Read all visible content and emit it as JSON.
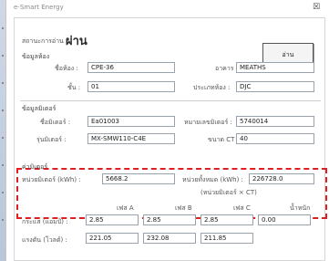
{
  "window": {
    "title": "e-Smart Energy",
    "close_label": "☒"
  },
  "status": {
    "label": "สถานะการอ่าน",
    "value": "ผ่าน",
    "button": "อ่าน"
  },
  "room": {
    "section": "ข้อมูลห้อง",
    "name_label": "ชื่อห้อง :",
    "name": "CPE-36",
    "building_label": "อาคาร :",
    "building": "MEATHS",
    "floor_label": "ชั้น :",
    "floor": "01",
    "type_label": "ประเภทห้อง :",
    "type": "DJC"
  },
  "meter": {
    "section": "ข้อมูลมิเตอร์",
    "name_label": "ชื่อมิเตอร์ :",
    "name": "Ea01003",
    "serial_label": "หมายเลขมิเตอร์ :",
    "serial": "5740014",
    "model_label": "รุ่นมิเตอร์ :",
    "model": "MX-SMW110-C4E",
    "ct_label": "ขนาด CT :",
    "ct": "40"
  },
  "reading": {
    "section": "ค่ามิเตอร์",
    "unit_label": "หน่วยมิเตอร์ (kWh) :",
    "unit": "5668.2",
    "total_label": "หน่วยทั้งหมด (kWh) :",
    "total": "226728.0",
    "note": "(หน่วยมิเตอร์ × CT)"
  },
  "phases": {
    "headers": [
      "เฟส A",
      "เฟส B",
      "เฟส C",
      "น้ำหนัก"
    ],
    "current_label": "กระแส (แอมป์) :",
    "current": [
      "2.85",
      "2.85",
      "2.85",
      "0.00"
    ],
    "voltage_label": "แรงดัน (โวลต์) :",
    "voltage": [
      "221.05",
      "232.08",
      "211.85"
    ]
  }
}
